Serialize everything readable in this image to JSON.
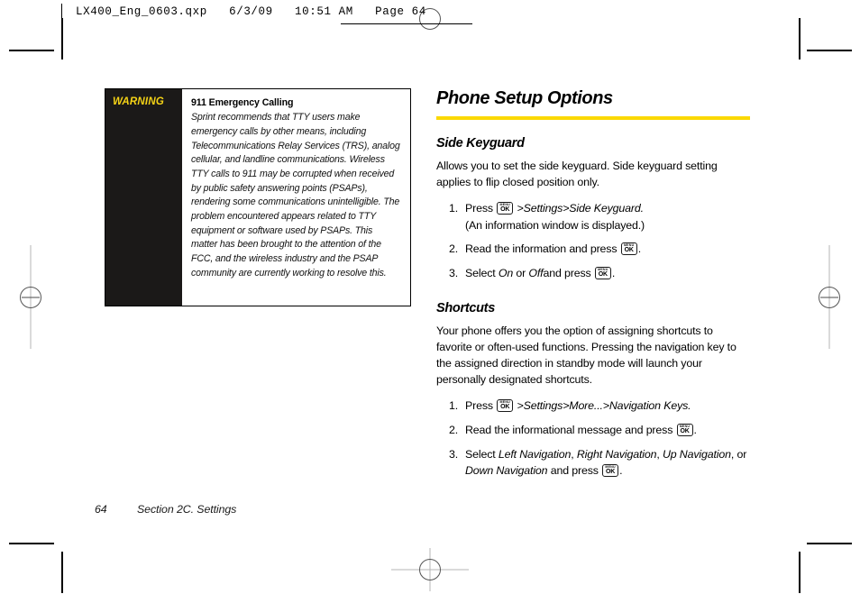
{
  "file_header": "LX400_Eng_0603.qxp   6/3/09   10:51 AM   Page 64",
  "warning": {
    "label": "WARNING",
    "title": "911 Emergency Calling",
    "body": "Sprint recommends that TTY users make emergency calls by other means, including Telecommunications Relay Services (TRS), analog cellular, and landline communications. Wireless TTY calls to 911 may be corrupted when received by public safety answering points (PSAPs), rendering some communications unintelligible. The problem encountered appears related to TTY equipment or software used by PSAPs. This matter has been brought to the attention of the FCC, and the wireless industry and the PSAP community are currently working to resolve this."
  },
  "chapter": {
    "title": "Phone Setup Options",
    "rule_color": "#fbd804"
  },
  "sections": [
    {
      "heading": "Side Keyguard",
      "intro": "Allows you to set the side keyguard. Side keyguard setting applies to flip closed position only.",
      "steps": [
        {
          "lead": "Press",
          "path": ">Settings>Side Keyguard.",
          "note": "(An information window is displayed.)"
        },
        {
          "lead": "Read the information and press",
          "tail": "."
        },
        {
          "lead": "Select",
          "opt1": "On",
          "joiner": "or",
          "opt2": "Off",
          "mid": "and press",
          "tail": "."
        }
      ]
    },
    {
      "heading": "Shortcuts",
      "intro": "Your phone offers you the option of assigning shortcuts to favorite or often-used functions. Pressing the navigation key to the assigned direction in standby mode will launch your personally designated shortcuts.",
      "steps": [
        {
          "lead": "Press",
          "path": ">Settings>More...>Navigation Keys."
        },
        {
          "lead": "Read the informational message  and press",
          "tail": "."
        },
        {
          "lead": "Select",
          "opt1": "Left Navigation",
          "opt2": "Right Navigation",
          "opt3": "Up Navigation",
          "joiner": "or",
          "opt4": "Down Navigation",
          "mid": "and press",
          "tail": "."
        }
      ]
    }
  ],
  "key_icon": {
    "menu_label": "MENU",
    "ok_label": "OK"
  },
  "footer": {
    "page_number": "64",
    "section_label": "Section 2C. Settings"
  }
}
